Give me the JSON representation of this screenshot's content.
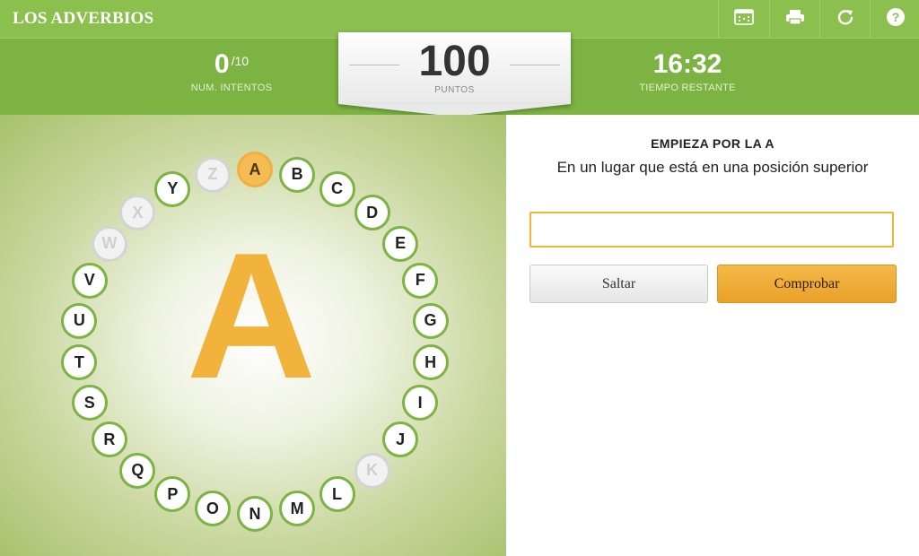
{
  "app": {
    "title": "LOS ADVERBIOS"
  },
  "toolbar": {
    "buttons": [
      {
        "name": "fullscreen-icon"
      },
      {
        "name": "print-icon"
      },
      {
        "name": "restart-icon"
      },
      {
        "name": "help-icon"
      }
    ]
  },
  "scoreboard": {
    "attempts_value": "0",
    "attempts_total": "/10",
    "attempts_label": "NUM. INTENTOS",
    "points_value": "100",
    "points_label": "PUNTOS",
    "time_value": "16:32",
    "time_label": "TIEMPO RESTANTE"
  },
  "wheel": {
    "current_letter": "A",
    "letters": [
      {
        "letter": "A",
        "state": "current"
      },
      {
        "letter": "B",
        "state": "pending"
      },
      {
        "letter": "C",
        "state": "pending"
      },
      {
        "letter": "D",
        "state": "pending"
      },
      {
        "letter": "E",
        "state": "pending"
      },
      {
        "letter": "F",
        "state": "pending"
      },
      {
        "letter": "G",
        "state": "pending"
      },
      {
        "letter": "H",
        "state": "pending"
      },
      {
        "letter": "I",
        "state": "pending"
      },
      {
        "letter": "J",
        "state": "pending"
      },
      {
        "letter": "K",
        "state": "skipped"
      },
      {
        "letter": "L",
        "state": "pending"
      },
      {
        "letter": "M",
        "state": "pending"
      },
      {
        "letter": "N",
        "state": "pending"
      },
      {
        "letter": "O",
        "state": "pending"
      },
      {
        "letter": "P",
        "state": "pending"
      },
      {
        "letter": "Q",
        "state": "pending"
      },
      {
        "letter": "R",
        "state": "pending"
      },
      {
        "letter": "S",
        "state": "pending"
      },
      {
        "letter": "T",
        "state": "pending"
      },
      {
        "letter": "U",
        "state": "pending"
      },
      {
        "letter": "V",
        "state": "pending"
      },
      {
        "letter": "W",
        "state": "skipped"
      },
      {
        "letter": "X",
        "state": "skipped"
      },
      {
        "letter": "Y",
        "state": "pending"
      },
      {
        "letter": "Z",
        "state": "skipped"
      }
    ]
  },
  "question": {
    "heading": "EMPIEZA POR LA A",
    "text": "En un lugar que está en una posición superior",
    "answer_value": ""
  },
  "actions": {
    "skip_label": "Saltar",
    "check_label": "Comprobar"
  },
  "colors": {
    "brand_green": "#8bbf4e",
    "score_green": "#7cb342",
    "accent_orange": "#f2b33d"
  }
}
